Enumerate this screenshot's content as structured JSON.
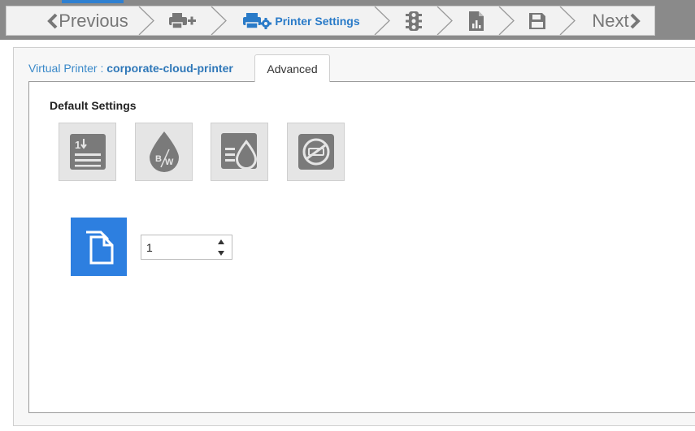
{
  "wizard": {
    "previous_label": "Previous",
    "next_label": "Next",
    "active_step_label": "Printer Settings",
    "colors": {
      "active": "#2a7bc8",
      "inactive": "#777777",
      "top_accent": "#2f80d1"
    }
  },
  "header": {
    "virtual_printer_label": "Virtual Printer :",
    "virtual_printer_name": "corporate-cloud-printer",
    "tab_label": "Advanced"
  },
  "default_settings": {
    "title": "Default Settings",
    "buttons": [
      {
        "icon": "page-order-icon"
      },
      {
        "icon": "black-white-drop-icon"
      },
      {
        "icon": "toner-save-icon"
      },
      {
        "icon": "no-staple-icon"
      }
    ]
  },
  "copies": {
    "icon": "copies-icon",
    "value": "1",
    "icon_color": "#2d7fe0"
  }
}
